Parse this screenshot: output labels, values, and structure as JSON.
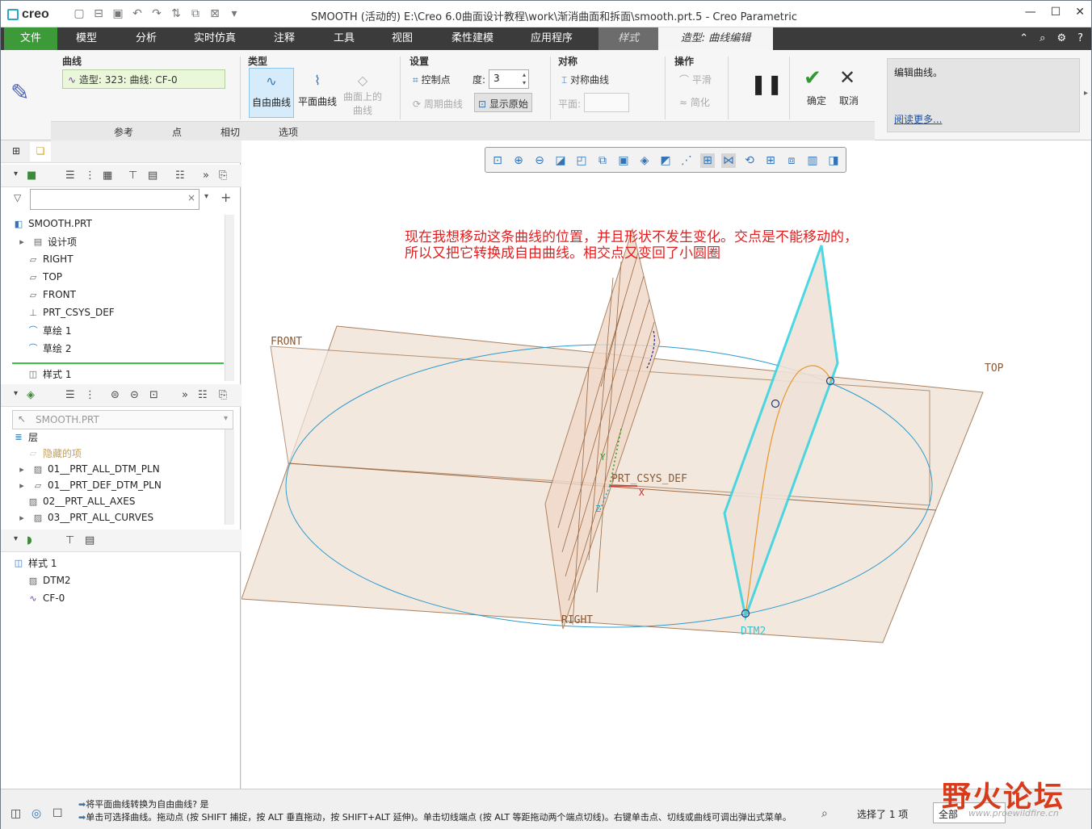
{
  "app": {
    "logo": "creo",
    "title": "SMOOTH (活动的) E:\\Creo 6.0曲面设计教程\\work\\渐消曲面和拆面\\smooth.prt.5 - Creo Parametric"
  },
  "menu": {
    "items": [
      "文件",
      "模型",
      "分析",
      "实时仿真",
      "注释",
      "工具",
      "视图",
      "柔性建模",
      "应用程序",
      "样式",
      "造型: 曲线编辑"
    ]
  },
  "ribbon": {
    "curve_group": "曲线",
    "curve_value": "造型: 323: 曲线: CF-0",
    "type_group": "类型",
    "type_free": "自由曲线",
    "type_plane": "平面曲线",
    "type_surface_1": "曲面上的",
    "type_surface_2": "曲线",
    "settings_group": "设置",
    "control_point": "控制点",
    "degree_label": "度:",
    "degree_value": "3",
    "periodic": "周期曲线",
    "show_original": "显示原始",
    "symmetry_group": "对称",
    "symmetric_curve": "对称曲线",
    "plane_label": "平面:",
    "ops_group": "操作",
    "smooth": "平滑",
    "simplify": "简化",
    "ok": "确定",
    "cancel": "取消",
    "help_text": "编辑曲线。",
    "help_link": "阅读更多...",
    "tabs": [
      "参考",
      "点",
      "相切",
      "选项"
    ]
  },
  "model_tree": {
    "root": "SMOOTH.PRT",
    "items": [
      "设计项",
      "RIGHT",
      "TOP",
      "FRONT",
      "PRT_CSYS_DEF",
      "草绘 1",
      "草绘 2",
      "样式 1"
    ]
  },
  "layer_tree": {
    "model_select": "SMOOTH.PRT",
    "header": "层",
    "items": [
      "隐藏的项",
      "01__PRT_ALL_DTM_PLN",
      "01__PRT_DEF_DTM_PLN",
      "02__PRT_ALL_AXES",
      "03__PRT_ALL_CURVES"
    ]
  },
  "style_tree": {
    "root": "样式 1",
    "items": [
      "DTM2",
      "CF-0"
    ]
  },
  "viewport": {
    "annotation_line1": "现在我想移动这条曲线的位置，并且形状不发生变化。交点是不能移动的，",
    "annotation_line2": "所以又把它转换成自由曲线。相交点又变回了小圆圈",
    "labels": {
      "front": "FRONT",
      "top": "TOP",
      "right": "RIGHT",
      "csys": "PRT_CSYS_DEF",
      "dtm2": "DTM2",
      "x": "X",
      "y": "Y",
      "z": "Z"
    }
  },
  "status": {
    "line1": "将平面曲线转换为自由曲线?  是",
    "line2": "单击可选择曲线。拖动点 (按 SHIFT 捕捉，按 ALT 垂直拖动，按 SHIFT+ALT 延伸)。单击切线端点 (按 ALT 等距拖动两个端点切线)。右键单击点、切线或曲线可调出弹出式菜单。",
    "selected": "选择了 1 项",
    "filter": "全部"
  },
  "watermark": {
    "text": "野火论坛",
    "url": "www.proewildfire.cn"
  }
}
